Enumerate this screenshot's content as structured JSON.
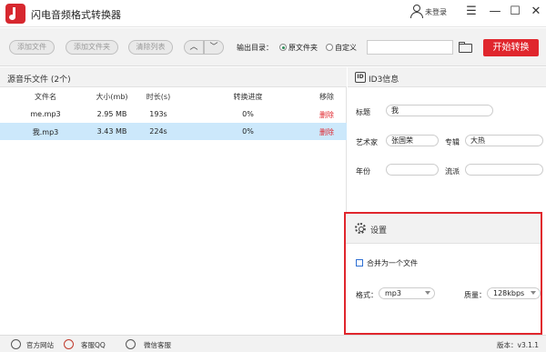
{
  "app": {
    "title": "闪电音频格式转换器"
  },
  "window": {
    "login_label": "未登录"
  },
  "toolbar": {
    "add_file": "添加文件",
    "add_folder": "添加文件夹",
    "clear_list": "清除列表",
    "output_dir_label": "输出目录：",
    "radio_source": "原文件夹",
    "radio_custom": "自定义",
    "selected_output": "原文件夹",
    "path_value": "",
    "start_button": "开始转换"
  },
  "file_list": {
    "title": "源音乐文件 (2个)",
    "columns": [
      "文件名",
      "大小(mb)",
      "时长(s)",
      "转换进度",
      "移除"
    ],
    "rows": [
      {
        "name": "me.mp3",
        "size": "2.95 MB",
        "duration": "193s",
        "progress": "0%",
        "remove": "删除",
        "selected": false
      },
      {
        "name": "我.mp3",
        "size": "3.43 MB",
        "duration": "224s",
        "progress": "0%",
        "remove": "删除",
        "selected": true
      }
    ]
  },
  "id3": {
    "title": "ID3信息",
    "icon_text": "ID",
    "fields": {
      "title_label": "标题",
      "title_value": "我",
      "artist_label": "艺术家",
      "artist_value": "张国荣",
      "album_label": "专辑",
      "album_value": "大热",
      "year_label": "年份",
      "year_value": "",
      "genre_label": "流派",
      "genre_value": ""
    }
  },
  "settings": {
    "title": "设置",
    "merge_label": "合并为一个文件",
    "merge_checked": false,
    "format_label": "格式：",
    "format_value": "mp3",
    "quality_label": "质量：",
    "quality_value": "128kbps",
    "highlight_color": "#e0262d"
  },
  "footer": {
    "site": "官方网站",
    "qq": "客服QQ",
    "wechat": "微信客服",
    "version": "版本：v3.1.1"
  },
  "colors": {
    "accent": "#e0262d",
    "selected_row": "#cce8fb",
    "header_bg": "#f2f2f2"
  }
}
